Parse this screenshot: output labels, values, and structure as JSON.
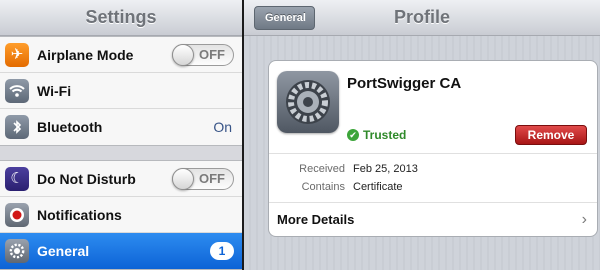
{
  "left_pane": {
    "title": "Settings",
    "groups": [
      {
        "items": [
          {
            "label": "Airplane Mode",
            "icon": "airplane-icon",
            "toggle": "OFF"
          },
          {
            "label": "Wi-Fi",
            "icon": "wifi-icon"
          },
          {
            "label": "Bluetooth",
            "icon": "bluetooth-icon",
            "value": "On"
          }
        ]
      },
      {
        "items": [
          {
            "label": "Do Not Disturb",
            "icon": "moon-icon",
            "toggle": "OFF"
          },
          {
            "label": "Notifications",
            "icon": "notifications-icon"
          },
          {
            "label": "General",
            "icon": "gear-icon",
            "badge": "1",
            "selected": true
          }
        ]
      }
    ]
  },
  "right_pane": {
    "back_button": "General",
    "title": "Profile",
    "card": {
      "name": "PortSwigger CA",
      "trusted": "Trusted",
      "remove_button": "Remove",
      "meta": [
        {
          "key": "Received",
          "value": "Feb 25, 2013"
        },
        {
          "key": "Contains",
          "value": "Certificate"
        }
      ],
      "more_details": "More Details"
    }
  },
  "colors": {
    "accent": "#0d63d6",
    "trusted": "#2f8a2a",
    "remove": "#a81616"
  }
}
